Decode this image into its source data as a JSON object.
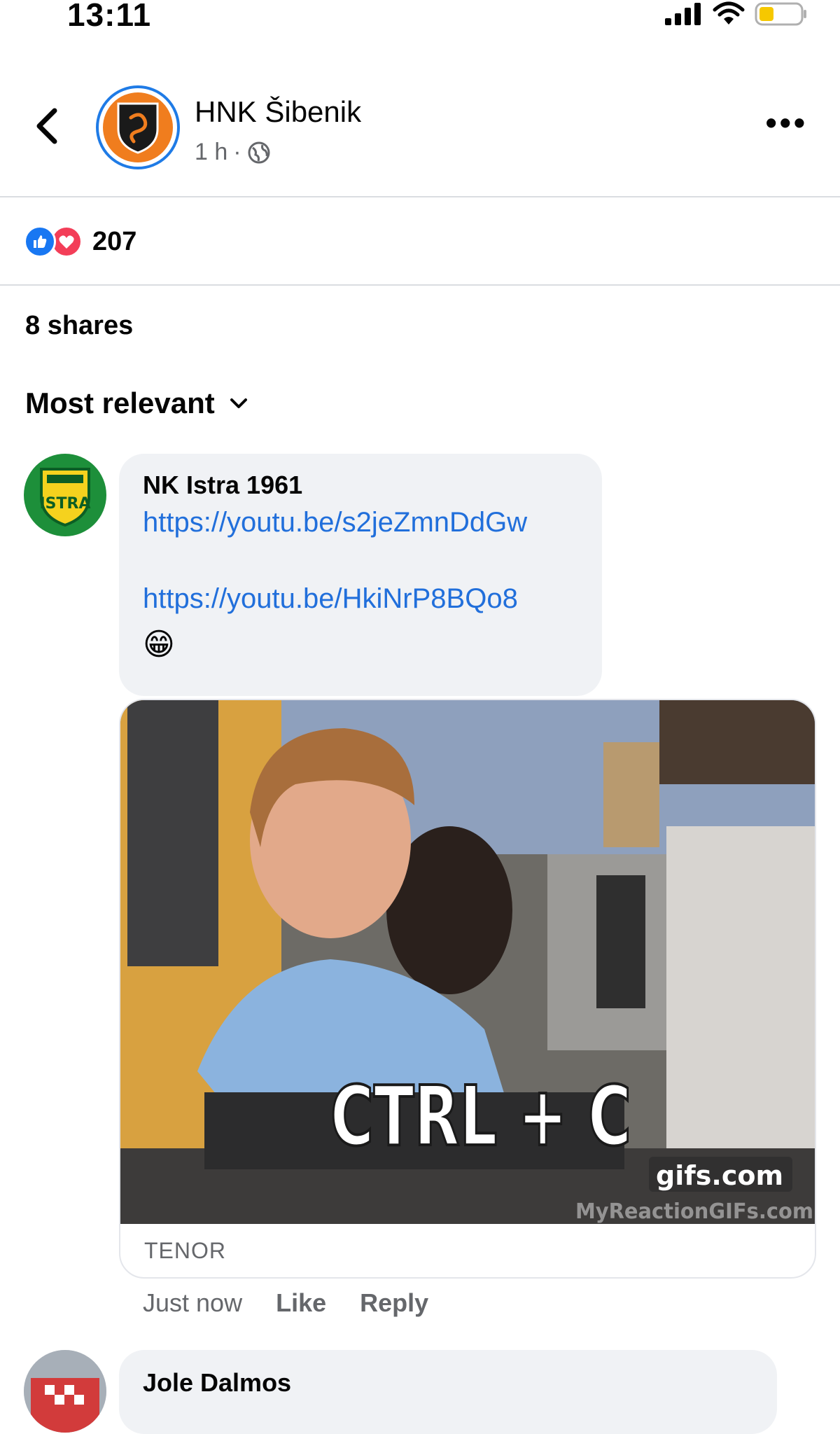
{
  "status_bar": {
    "time": "13:11"
  },
  "header": {
    "page_name": "HNK Šibenik",
    "time_ago": "1 h",
    "separator": "·"
  },
  "post_stats": {
    "reaction_count": "207",
    "shares": "8 shares"
  },
  "comments_sort": "Most relevant",
  "comments": [
    {
      "author": "NK Istra 1961",
      "links": [
        "https://youtu.be/s2jeZmnDdGw",
        "https://youtu.be/HkiNrP8BQo8"
      ],
      "emoji": "😁",
      "gif": {
        "caption": "CTRL + C",
        "watermark": "gifs.com",
        "watermark2": "MyReactionGIFs.com",
        "source": "TENOR"
      },
      "time": "Just now",
      "like_label": "Like",
      "reply_label": "Reply"
    },
    {
      "author": "Jole Dalmos"
    }
  ],
  "colors": {
    "link": "#216fdb",
    "like_blue": "#1877f2",
    "love_red": "#f33e58",
    "muted": "#65676b",
    "bubble": "#f0f2f5",
    "avatar_ring": "#1f7be6",
    "avatar_orange": "#f07d1e"
  }
}
